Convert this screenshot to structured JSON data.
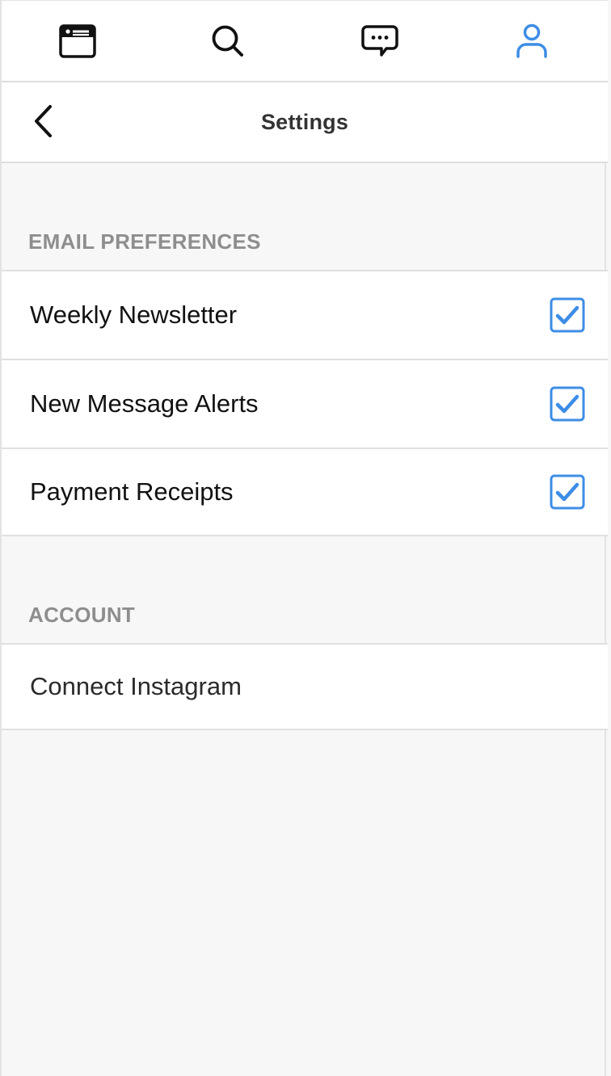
{
  "colors": {
    "accent": "#3d8de6",
    "section_label": "#8e8e8e",
    "background": "#f7f7f7"
  },
  "nav": {
    "items": [
      {
        "icon": "browser-window-icon",
        "active": false
      },
      {
        "icon": "search-icon",
        "active": false
      },
      {
        "icon": "message-bubble-icon",
        "active": false
      },
      {
        "icon": "user-profile-icon",
        "active": true
      }
    ]
  },
  "header": {
    "back_icon": "chevron-left-icon",
    "title": "Settings"
  },
  "email_preferences": {
    "label": "EMAIL PREFERENCES",
    "items": [
      {
        "label": "Weekly Newsletter",
        "checked": true
      },
      {
        "label": "New Message Alerts",
        "checked": true
      },
      {
        "label": "Payment Receipts",
        "checked": true
      }
    ]
  },
  "account": {
    "label": "ACCOUNT",
    "items": [
      {
        "label": "Connect Instagram"
      }
    ]
  }
}
